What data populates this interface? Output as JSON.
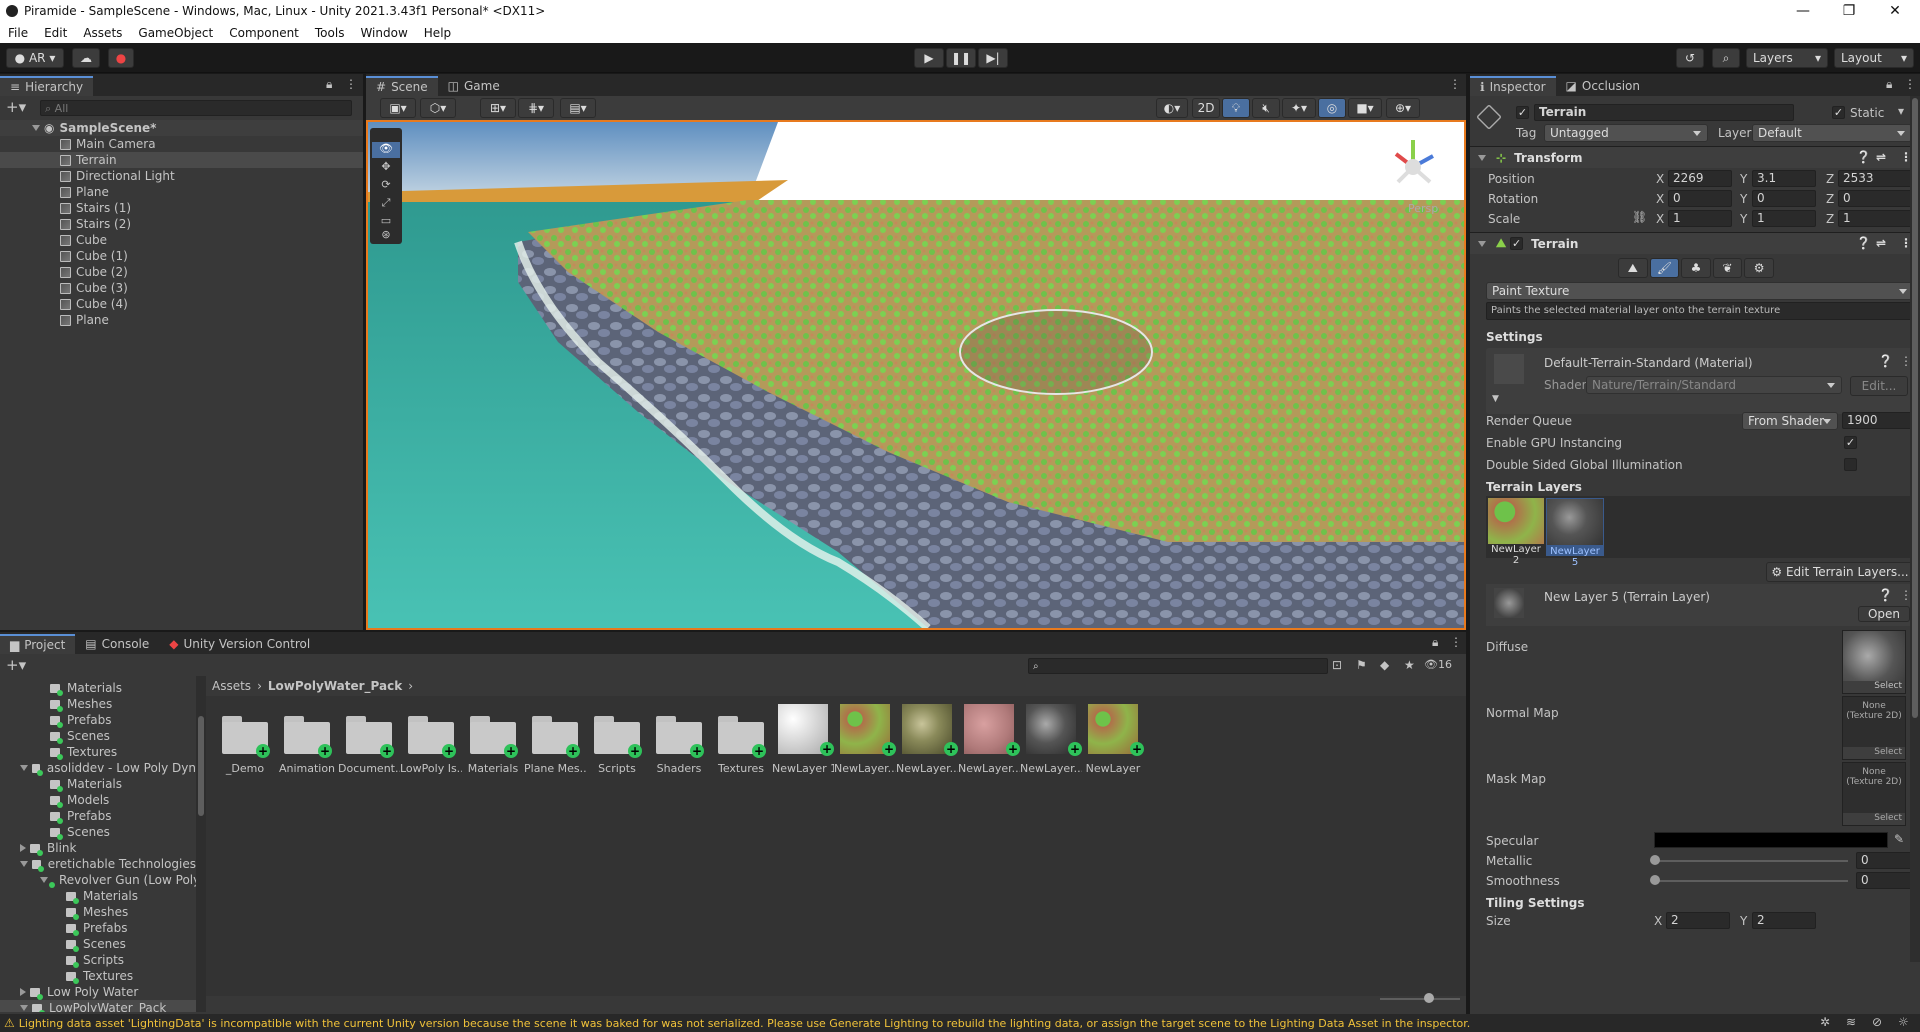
{
  "window": {
    "title": "Piramide - SampleScene - Windows, Mac, Linux - Unity 2021.3.43f1 Personal* <DX11>",
    "controls": [
      "—",
      "❐",
      "✕"
    ]
  },
  "menu": [
    "File",
    "Edit",
    "Assets",
    "GameObject",
    "Component",
    "Tools",
    "Window",
    "Help"
  ],
  "toolbar": {
    "account": "AR",
    "layers": "Layers",
    "layout": "Layout"
  },
  "hierarchy": {
    "tab": "Hierarchy",
    "search_placeholder": "All",
    "scene": "SampleScene*",
    "items": [
      "Main Camera",
      "Terrain",
      "Directional Light",
      "Plane",
      "Stairs (1)",
      "Stairs (2)",
      "Cube",
      "Cube (1)",
      "Cube (2)",
      "Cube (3)",
      "Cube (4)",
      "Plane"
    ]
  },
  "scene_tabs": {
    "scene": "Scene",
    "game": "Game",
    "btn_2d": "2D",
    "persp": "Persp"
  },
  "project": {
    "tabs": [
      "Project",
      "Console",
      "Unity Version Control"
    ],
    "tree": [
      {
        "label": "Materials",
        "indent": 2,
        "arrow": ""
      },
      {
        "label": "Meshes",
        "indent": 2,
        "arrow": ""
      },
      {
        "label": "Prefabs",
        "indent": 2,
        "arrow": ""
      },
      {
        "label": "Scenes",
        "indent": 2,
        "arrow": ""
      },
      {
        "label": "Textures",
        "indent": 2,
        "arrow": ""
      },
      {
        "label": "asoliddev - Low Poly Dyn",
        "indent": 1,
        "arrow": "down"
      },
      {
        "label": "Materials",
        "indent": 2,
        "arrow": ""
      },
      {
        "label": "Models",
        "indent": 2,
        "arrow": ""
      },
      {
        "label": "Prefabs",
        "indent": 2,
        "arrow": ""
      },
      {
        "label": "Scenes",
        "indent": 2,
        "arrow": ""
      },
      {
        "label": "Blink",
        "indent": 1,
        "arrow": "right"
      },
      {
        "label": "eretichable Technologies",
        "indent": 1,
        "arrow": "down"
      },
      {
        "label": "Revolver Gun (Low Poly",
        "indent": 2,
        "arrow": "down"
      },
      {
        "label": "Materials",
        "indent": 3,
        "arrow": ""
      },
      {
        "label": "Meshes",
        "indent": 3,
        "arrow": ""
      },
      {
        "label": "Prefabs",
        "indent": 3,
        "arrow": ""
      },
      {
        "label": "Scenes",
        "indent": 3,
        "arrow": ""
      },
      {
        "label": "Scripts",
        "indent": 3,
        "arrow": ""
      },
      {
        "label": "Textures",
        "indent": 3,
        "arrow": ""
      },
      {
        "label": "Low Poly Water",
        "indent": 1,
        "arrow": "right"
      },
      {
        "label": "LowPolyWater_Pack",
        "indent": 1,
        "arrow": "down"
      }
    ],
    "breadcrumb": [
      "Assets",
      "LowPolyWater_Pack"
    ],
    "count": "16",
    "assets": [
      {
        "label": "_Demo",
        "kind": "folder"
      },
      {
        "label": "Animation",
        "kind": "folder"
      },
      {
        "label": "Document...",
        "kind": "folder"
      },
      {
        "label": "LowPoly Is...",
        "kind": "folder"
      },
      {
        "label": "Materials",
        "kind": "folder"
      },
      {
        "label": "Plane Mes...",
        "kind": "folder"
      },
      {
        "label": "Scripts",
        "kind": "folder"
      },
      {
        "label": "Shaders",
        "kind": "folder"
      },
      {
        "label": "Textures",
        "kind": "folder"
      },
      {
        "label": "NewLayer 1",
        "kind": "snow"
      },
      {
        "label": "NewLayer...",
        "kind": "grass"
      },
      {
        "label": "NewLayer...",
        "kind": "moss"
      },
      {
        "label": "NewLayer...",
        "kind": "pink"
      },
      {
        "label": "NewLayer...",
        "kind": "rock"
      },
      {
        "label": "NewLayer",
        "kind": "grass"
      }
    ]
  },
  "inspector": {
    "tabs": [
      "Inspector",
      "Occlusion"
    ],
    "object_name": "Terrain",
    "static_label": "Static",
    "tag_label": "Tag",
    "tag_value": "Untagged",
    "layer_label": "Layer",
    "layer_value": "Default",
    "transform": {
      "title": "Transform",
      "position": {
        "label": "Position",
        "x": "2269",
        "y": "3.1",
        "z": "2533"
      },
      "rotation": {
        "label": "Rotation",
        "x": "0",
        "y": "0",
        "z": "0"
      },
      "scale": {
        "label": "Scale",
        "x": "1",
        "y": "1",
        "z": "1"
      }
    },
    "terrain": {
      "title": "Terrain",
      "mode": "Paint Texture",
      "help": "Paints the selected material layer onto the terrain texture",
      "settings": "Settings",
      "material": "Default-Terrain-Standard (Material)",
      "shader_label": "Shader",
      "shader_value": "Nature/Terrain/Standard",
      "edit": "Edit...",
      "render_queue_label": "Render Queue",
      "render_queue_mode": "From Shader",
      "render_queue_value": "1900",
      "gpu_label": "Enable GPU Instancing",
      "gpu_checked": "✓",
      "dsgi_label": "Double Sided Global Illumination",
      "layers_title": "Terrain Layers",
      "layer_a": "NewLayer 2",
      "layer_b": "NewLayer 5",
      "edit_layers": "Edit Terrain Layers...",
      "layer_detail": "New Layer 5 (Terrain Layer)",
      "open": "Open",
      "diffuse": "Diffuse",
      "normal": "Normal Map",
      "mask": "Mask Map",
      "none_tex": "None (Texture 2D)",
      "select": "Select",
      "specular": "Specular",
      "metallic": "Metallic",
      "metallic_value": "0",
      "smoothness": "Smoothness",
      "smoothness_value": "0",
      "tiling": "Tiling Settings",
      "size_label": "Size",
      "size_x": "2",
      "size_y": "2"
    }
  },
  "axes": {
    "x": "X",
    "y": "Y",
    "z": "Z"
  },
  "status": {
    "message": "Lighting data asset 'LightingData' is incompatible with the current Unity version because the scene it was baked for was not serialized. Please use Generate Lighting to rebuild the lighting data, or assign the target scene to the Lighting Data Asset in the inspector."
  },
  "colors": {
    "accent": "#5a8fd6",
    "warning": "#f0c23a",
    "scene_border": "#e87a1e"
  }
}
